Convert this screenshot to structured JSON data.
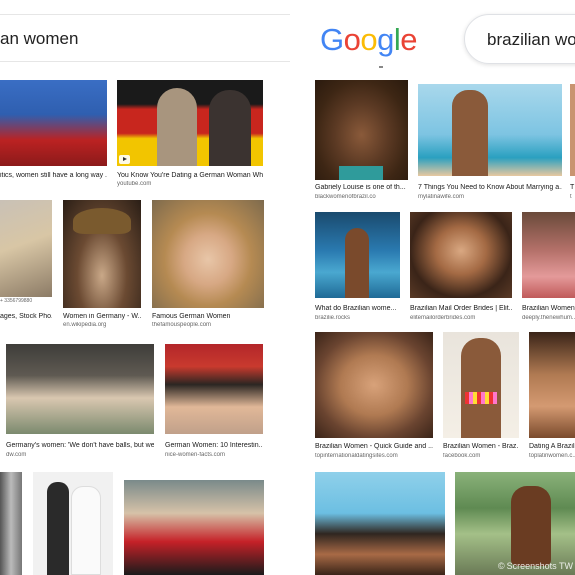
{
  "left": {
    "query": "an women",
    "results": [
      {
        "title": "itics, women still have a long way ...",
        "source": ""
      },
      {
        "title": "You Know You're Dating a German Woman Wh...",
        "source": "youtube.com"
      },
      {
        "title": "",
        "source": ""
      },
      {
        "title": "",
        "source": ""
      },
      {
        "title": "ages, Stock Pho...",
        "source": ""
      },
      {
        "title": "Women in Germany - W...",
        "source": "en.wikipedia.org"
      },
      {
        "title": "Famous German Women",
        "source": "thefamouspeople.com"
      },
      {
        "title": "Germany's women: 'We don't have balls, but we...",
        "source": "dw.com"
      },
      {
        "title": "German Women: 10 Interestin...",
        "source": "nice-women-facts.com"
      },
      {
        "title": "",
        "source": ""
      },
      {
        "title": "",
        "source": ""
      },
      {
        "title": "",
        "source": ""
      }
    ],
    "tiny_caption": "+ 3356799880"
  },
  "right": {
    "logo_letters": [
      "G",
      "o",
      "o",
      "g",
      "l",
      "e"
    ],
    "query": "brazilian wo",
    "results": [
      {
        "title": "Gabriely Louise is one of th...",
        "source": "blackwomenofbrazil.co"
      },
      {
        "title": "7 Things You Need to Know About Marrying a...",
        "source": "mylatinawife.com"
      },
      {
        "title": "T",
        "source": "t"
      },
      {
        "title": "What do Brazilian wome...",
        "source": "brazilie.rocks"
      },
      {
        "title": "Brazilian Mail Order Brides | Elit...",
        "source": "elitemailorderbrides.com"
      },
      {
        "title": "Brazilian Women",
        "source": "deeply.thenewhum..."
      },
      {
        "title": "Brazilian Women - Quick Guide and ...",
        "source": "topinternationaldatingsites.com"
      },
      {
        "title": "Brazilian Women - Braz...",
        "source": "facebook.com"
      },
      {
        "title": "Dating A Brazilia...",
        "source": "toplatinwomen.c..."
      },
      {
        "title": "",
        "source": ""
      },
      {
        "title": "",
        "source": ""
      }
    ],
    "watermark": "Screenshots TW"
  },
  "colors": {
    "google_blue": "#4285F4",
    "google_red": "#EA4335",
    "google_yellow": "#FBBC05",
    "google_green": "#34A853"
  }
}
